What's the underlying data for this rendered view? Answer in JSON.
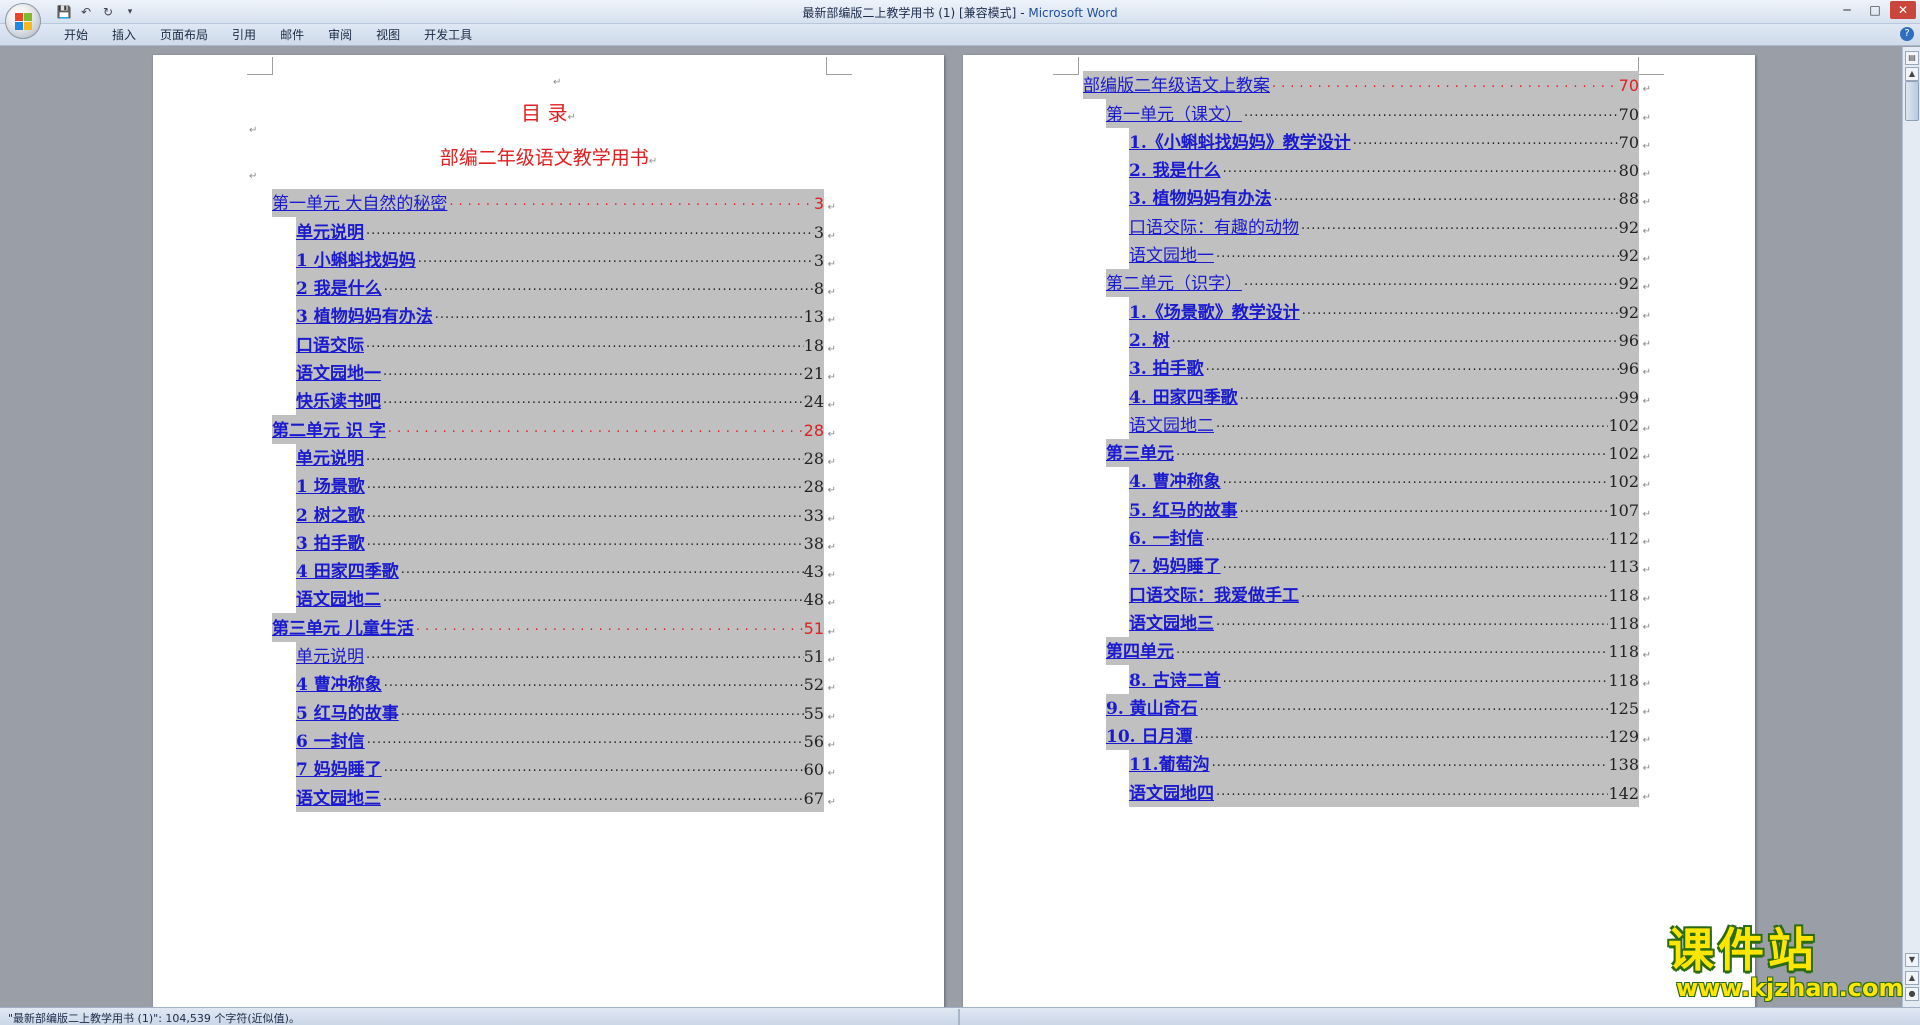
{
  "window": {
    "title": "最新部编版二上教学用书 (1) [兼容模式]",
    "app_name": "Microsoft Word",
    "title_separator": " - "
  },
  "quick_access": {
    "save_icon": "save-icon",
    "undo_icon": "undo-icon",
    "redo_icon": "redo-icon",
    "customize_icon": "customize-icon"
  },
  "ribbon": {
    "tabs": [
      "开始",
      "插入",
      "页面布局",
      "引用",
      "邮件",
      "审阅",
      "视图",
      "开发工具"
    ]
  },
  "page1": {
    "heading": "目  录",
    "subheading": "部编二年级语文教学用书",
    "entries": [
      {
        "label": "第一单元    大自然的秘密",
        "page": "3",
        "level": 0,
        "red": true,
        "bold": false
      },
      {
        "label": "单元说明",
        "page": "3",
        "level": 1,
        "red": false,
        "bold": true
      },
      {
        "label": "1   小蝌蚪找妈妈",
        "page": "3",
        "level": 1,
        "red": false,
        "bold": true
      },
      {
        "label": "2 我是什么",
        "page": "8",
        "level": 1,
        "red": false,
        "bold": true
      },
      {
        "label": "3 植物妈妈有办法",
        "page": "13",
        "level": 1,
        "red": false,
        "bold": true
      },
      {
        "label": "口语交际",
        "page": "18",
        "level": 1,
        "red": false,
        "bold": true
      },
      {
        "label": "语文园地一",
        "page": "21",
        "level": 1,
        "red": false,
        "bold": true
      },
      {
        "label": "快乐读书吧",
        "page": "24",
        "level": 1,
        "red": false,
        "bold": true
      },
      {
        "label": "第二单元        识   字",
        "page": "28",
        "level": 0,
        "red": true,
        "bold": true
      },
      {
        "label": "单元说明",
        "page": "28",
        "level": 1,
        "red": false,
        "bold": true
      },
      {
        "label": "1   场景歌",
        "page": "28",
        "level": 1,
        "red": false,
        "bold": true
      },
      {
        "label": "2 树之歌",
        "page": "33",
        "level": 1,
        "red": false,
        "bold": true
      },
      {
        "label": "3 拍手歌",
        "page": "38",
        "level": 1,
        "red": false,
        "bold": true
      },
      {
        "label": "4   田家四季歌",
        "page": "43",
        "level": 1,
        "red": false,
        "bold": true
      },
      {
        "label": "语文园地二",
        "page": "48",
        "level": 1,
        "red": false,
        "bold": true
      },
      {
        "label": "第三单元     儿童生活",
        "page": "51",
        "level": 0,
        "red": true,
        "bold": true
      },
      {
        "label": "单元说明",
        "page": "51",
        "level": 1,
        "red": false,
        "bold": false
      },
      {
        "label": "4   曹冲称象",
        "page": "52",
        "level": 1,
        "red": false,
        "bold": true
      },
      {
        "label": "5   红马的故事",
        "page": "55",
        "level": 1,
        "red": false,
        "bold": true
      },
      {
        "label": "6   一封信",
        "page": "56",
        "level": 1,
        "red": false,
        "bold": true
      },
      {
        "label": "7   妈妈睡了",
        "page": "60",
        "level": 1,
        "red": false,
        "bold": true
      },
      {
        "label": "语文园地三",
        "page": "67",
        "level": 1,
        "red": false,
        "bold": true
      }
    ]
  },
  "page2": {
    "entries": [
      {
        "label": "部编版二年级语文上教案",
        "page": "70",
        "level": 0,
        "red": true,
        "bold": false
      },
      {
        "label": "第一单元（课文）",
        "page": "70",
        "level": 1,
        "red": false,
        "bold": false
      },
      {
        "label": "1.《小蝌蚪找妈妈》教学设计",
        "page": "70",
        "level": 2,
        "red": false,
        "bold": true
      },
      {
        "label": "2.  我是什么",
        "page": "80",
        "level": 2,
        "red": false,
        "bold": true
      },
      {
        "label": "3. 植物妈妈有办法",
        "page": "88",
        "level": 2,
        "red": false,
        "bold": true
      },
      {
        "label": "口语交际：有趣的动物",
        "page": "92",
        "level": 2,
        "red": false,
        "bold": false
      },
      {
        "label": "语文园地一",
        "page": "92",
        "level": 2,
        "red": false,
        "bold": false
      },
      {
        "label": "第二单元（识字）",
        "page": "92",
        "level": 1,
        "red": false,
        "bold": false
      },
      {
        "label": "1.《场景歌》教学设计",
        "page": "92",
        "level": 2,
        "red": false,
        "bold": true
      },
      {
        "label": "2. 树",
        "page": "96",
        "level": 2,
        "red": false,
        "bold": true
      },
      {
        "label": "3. 拍手歌",
        "page": "96",
        "level": 2,
        "red": false,
        "bold": true
      },
      {
        "label": "4.  田家四季歌",
        "page": "99",
        "level": 2,
        "red": false,
        "bold": true
      },
      {
        "label": "语文园地二",
        "page": "102",
        "level": 2,
        "red": false,
        "bold": false
      },
      {
        "label": "第三单元",
        "page": "102",
        "level": 1,
        "red": false,
        "bold": true
      },
      {
        "label": "4. 曹冲称象",
        "page": "102",
        "level": 2,
        "red": false,
        "bold": true
      },
      {
        "label": "5. 红马的故事",
        "page": "107",
        "level": 2,
        "red": false,
        "bold": true
      },
      {
        "label": "6. 一封信",
        "page": "112",
        "level": 2,
        "red": false,
        "bold": true
      },
      {
        "label": "7. 妈妈睡了",
        "page": "113",
        "level": 2,
        "red": false,
        "bold": true
      },
      {
        "label": "口语交际：我爱做手工",
        "page": "118",
        "level": 2,
        "red": false,
        "bold": true
      },
      {
        "label": "语文园地三",
        "page": "118",
        "level": 2,
        "red": false,
        "bold": true
      },
      {
        "label": "第四单元",
        "page": "118",
        "level": 1,
        "red": false,
        "bold": true
      },
      {
        "label": "8. 古诗二首",
        "page": "118",
        "level": 2,
        "red": false,
        "bold": true
      },
      {
        "label": "9. 黄山奇石",
        "page": "125",
        "level": 1,
        "red": false,
        "bold": true
      },
      {
        "label": "10. 日月潭",
        "page": "129",
        "level": 1,
        "red": false,
        "bold": true
      },
      {
        "label": "11.葡萄沟",
        "page": "138",
        "level": 2,
        "red": false,
        "bold": true
      },
      {
        "label": "语文园地四",
        "page": "142",
        "level": 2,
        "red": false,
        "bold": true
      }
    ]
  },
  "statusbar": {
    "text": "\"最新部编版二上教学用书 (1)\": 104,539 个字符(近似值)。"
  },
  "watermark": {
    "name": "课件站",
    "url": "www.kjzhan.com"
  },
  "colors": {
    "link_blue": "#1a1ad0",
    "heading_red": "#e02020",
    "toc_highlight": "#c0c0c0"
  }
}
